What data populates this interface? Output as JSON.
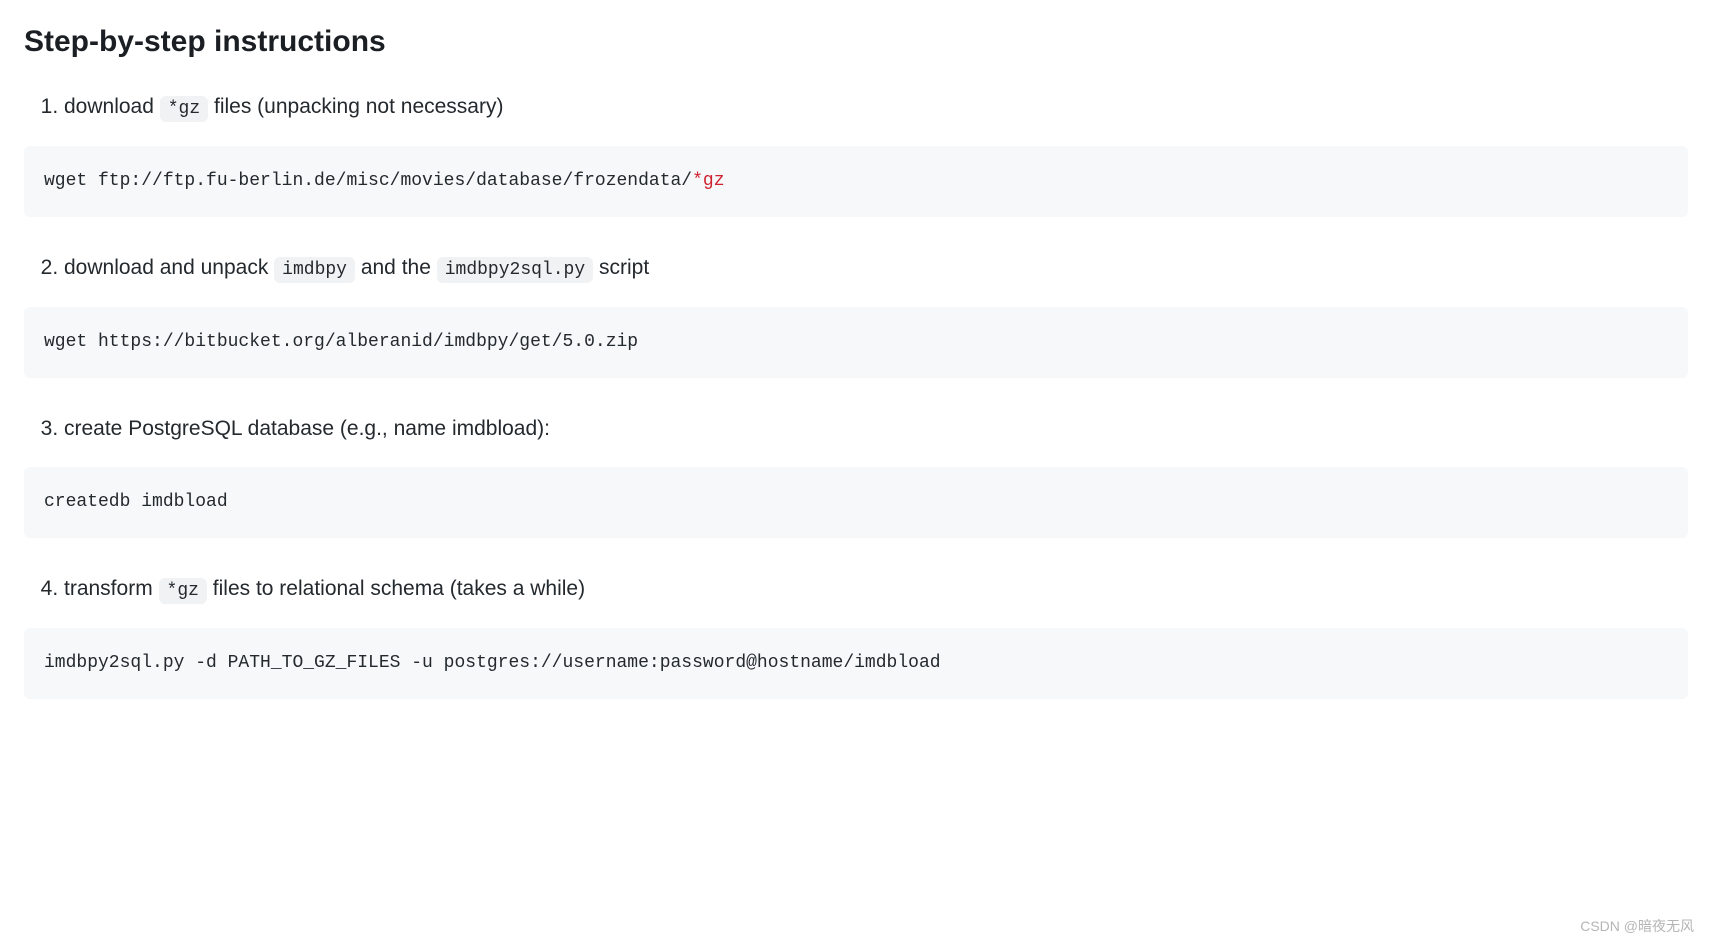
{
  "heading": "Step-by-step instructions",
  "steps": [
    {
      "parts": [
        {
          "text": "download "
        },
        {
          "code": "*gz"
        },
        {
          "text": " files (unpacking not necessary)"
        }
      ],
      "code_prefix": "wget ftp://ftp.fu-berlin.de/misc/movies/database/frozendata/",
      "code_glob": "*gz"
    },
    {
      "parts": [
        {
          "text": "download and unpack "
        },
        {
          "code": "imdbpy"
        },
        {
          "text": " and the "
        },
        {
          "code": "imdbpy2sql.py"
        },
        {
          "text": " script"
        }
      ],
      "code_prefix": "wget https://bitbucket.org/alberanid/imdbpy/get/5.0.zip",
      "code_glob": ""
    },
    {
      "parts": [
        {
          "text": "create PostgreSQL database (e.g., name imdbload):"
        }
      ],
      "code_prefix": "createdb imdbload",
      "code_glob": ""
    },
    {
      "parts": [
        {
          "text": "transform "
        },
        {
          "code": "*gz"
        },
        {
          "text": " files to relational schema (takes a while)"
        }
      ],
      "code_prefix": "imdbpy2sql.py -d PATH_TO_GZ_FILES -u postgres://username:password@hostname/imdbload",
      "code_glob": ""
    }
  ],
  "watermark": "CSDN @暗夜无风"
}
